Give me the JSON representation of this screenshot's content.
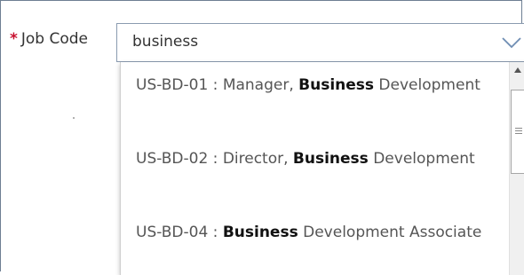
{
  "field": {
    "required_marker": "*",
    "label": "Job Code",
    "input_value": "business"
  },
  "options": [
    {
      "prefix": "US-BD-01 : Manager, ",
      "bold": "Business",
      "suffix": " Development"
    },
    {
      "prefix": "US-BD-02 : Director, ",
      "bold": "Business",
      "suffix": " Development"
    },
    {
      "prefix": "US-BD-04 : ",
      "bold": "Business",
      "suffix": " Development Associate"
    }
  ],
  "icons": {
    "dropdown": "chevron-down-icon",
    "scroll_up": "scroll-up-arrow-icon"
  },
  "colors": {
    "required": "#c8102e",
    "chevron": "#6e8db3",
    "border": "#8a9bb0"
  }
}
